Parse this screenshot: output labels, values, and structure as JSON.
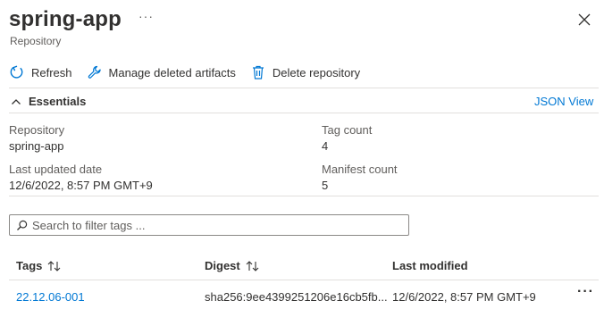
{
  "header": {
    "title": "spring-app",
    "more": "···",
    "subtitle": "Repository"
  },
  "toolbar": {
    "refresh_label": "Refresh",
    "manage_label": "Manage deleted artifacts",
    "delete_label": "Delete repository"
  },
  "essentials": {
    "label": "Essentials",
    "json_view": "JSON View",
    "fields": {
      "repository_label": "Repository",
      "repository_value": "spring-app",
      "tag_count_label": "Tag count",
      "tag_count_value": "4",
      "last_updated_label": "Last updated date",
      "last_updated_value": "12/6/2022, 8:57 PM GMT+9",
      "manifest_count_label": "Manifest count",
      "manifest_count_value": "5"
    }
  },
  "search": {
    "placeholder": "Search to filter tags ..."
  },
  "table": {
    "headers": {
      "tags": "Tags",
      "digest": "Digest",
      "last_modified": "Last modified"
    },
    "rows": [
      {
        "tag": "22.12.06-001",
        "digest": "sha256:9ee4399251206e16cb5fb...",
        "last_modified": "12/6/2022, 8:57 PM GMT+9",
        "more": "···"
      }
    ]
  },
  "colors": {
    "accent": "#0078d4",
    "text": "#323130",
    "subtle": "#605e5c",
    "divider": "#e1dfdd"
  },
  "icons": [
    "refresh-icon",
    "wrench-icon",
    "trash-icon",
    "chevron-up-icon",
    "search-icon",
    "sort-icon",
    "close-icon"
  ]
}
